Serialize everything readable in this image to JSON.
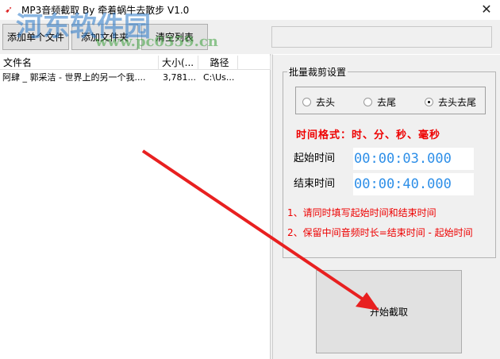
{
  "window": {
    "title": "MP3音频截取 By 牵着蜗牛去散步 V1.0",
    "close": "✕"
  },
  "watermark": {
    "name": "河东软件园",
    "url": "www.pc0359.cn"
  },
  "toolbar": {
    "add_file": "添加单个文件",
    "add_folder": "添加文件夹",
    "clear_list": "清空列表",
    "path_value": ""
  },
  "list": {
    "columns": [
      "文件名",
      "大小(...",
      "路径"
    ],
    "rows": [
      [
        "阿肆 _ 郭采洁 - 世界上的另一个我....",
        "3,781...",
        "C:\\Us..."
      ]
    ]
  },
  "settings": {
    "group_title": "批量裁剪设置",
    "modes": [
      {
        "label": "去头",
        "selected": false
      },
      {
        "label": "去尾",
        "selected": false
      },
      {
        "label": "去头去尾",
        "selected": true
      }
    ],
    "format_hint": "时间格式：时、分、秒、毫秒",
    "start_label": "起始时间",
    "start_value": "00:00:03.000",
    "end_label": "结束时间",
    "end_value": "00:00:40.000",
    "note1": "1、请同时填写起始时间和结束时间",
    "note2": "2、保留中间音频时长=结束时间 - 起始时间"
  },
  "start_button": "开始截取",
  "colors": {
    "accent_red": "#e00000",
    "time_blue": "#2e8fe8"
  }
}
